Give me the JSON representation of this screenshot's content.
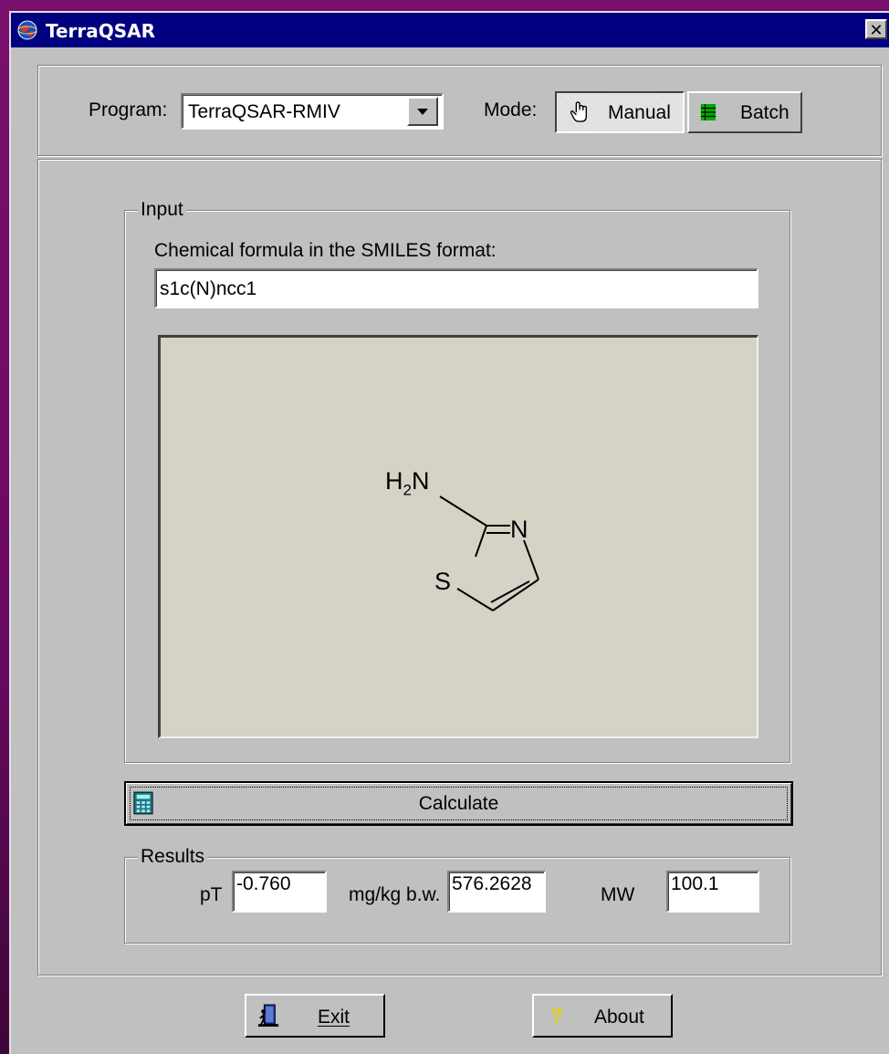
{
  "window": {
    "title": "TerraQSAR",
    "close_glyph": "✕"
  },
  "toolbar": {
    "program_label": "Program:",
    "program_value": "TerraQSAR-RMIV",
    "mode_label": "Mode:",
    "manual_label": "Manual",
    "batch_label": "Batch",
    "selected_mode": "Manual"
  },
  "input": {
    "legend": "Input",
    "smiles_label": "Chemical formula in the SMILES format:",
    "smiles_value": "s1c(N)ncc1",
    "structure": {
      "h2n_main": "H",
      "h2n_sub": "2",
      "h2n_tail": "N",
      "n_ring": "N",
      "s_ring": "S"
    }
  },
  "calculate": {
    "label": "Calculate"
  },
  "results": {
    "legend": "Results",
    "pt_label": "pT",
    "pt_value": "-0.760",
    "mgkg_label": "mg/kg b.w.",
    "mgkg_value": "576.2628",
    "mw_label": "MW",
    "mw_value": "100.1"
  },
  "footer": {
    "exit_label": "Exit",
    "about_label": "About"
  },
  "icons": {
    "app": "globe-icon",
    "manual": "hand-pointer-icon",
    "batch": "batch-grid-icon",
    "calculate": "calculator-icon",
    "exit": "exit-door-icon",
    "about": "question-mark-icon"
  },
  "colors": {
    "titlebar": "#000080",
    "face": "#c0c0c0",
    "desktop": "#7a0f6e",
    "drawing_bg": "#d4d3c6"
  }
}
